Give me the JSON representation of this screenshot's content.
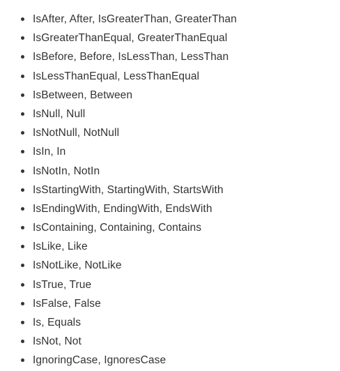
{
  "keywords": [
    "IsAfter, After, IsGreaterThan, GreaterThan",
    "IsGreaterThanEqual, GreaterThanEqual",
    "IsBefore, Before, IsLessThan, LessThan",
    "IsLessThanEqual, LessThanEqual",
    "IsBetween, Between",
    "IsNull, Null",
    "IsNotNull, NotNull",
    "IsIn, In",
    "IsNotIn, NotIn",
    "IsStartingWith, StartingWith, StartsWith",
    "IsEndingWith, EndingWith, EndsWith",
    "IsContaining, Containing, Contains",
    "IsLike, Like",
    "IsNotLike, NotLike",
    "IsTrue, True",
    "IsFalse, False",
    "Is, Equals",
    "IsNot, Not",
    "IgnoringCase, IgnoresCase"
  ]
}
